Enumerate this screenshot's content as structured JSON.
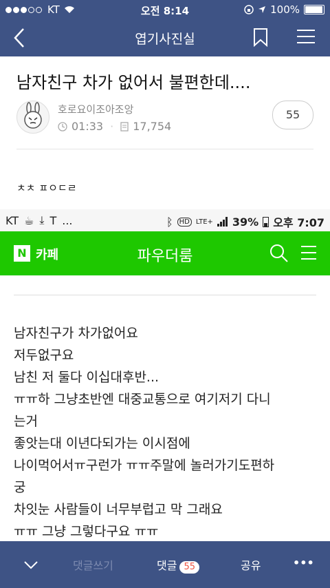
{
  "status_bar": {
    "carrier": "KT",
    "time": "오전 8:14",
    "battery_percent": "100%"
  },
  "nav": {
    "title": "엽기사진실"
  },
  "post": {
    "title": "남자친구 차가 없어서 불편한데....",
    "author": "호로요이조아조앙",
    "duration": "01:33",
    "views": "17,754",
    "comment_count": "55",
    "text": "ㅊㅊ ㅍㅇㄷㄹ"
  },
  "embedded": {
    "status": {
      "carrier": "KT",
      "more": "...",
      "battery": "39%",
      "time": "오후 7:07",
      "hd": "HD",
      "lte": "LTE+"
    },
    "header": {
      "logo": "N",
      "cafe_label": "카페",
      "cafe_name": "파우더룸"
    },
    "lines": [
      "남자친구가 차가없어요",
      "저두없구요",
      "남친 저 둘다 이십대후반...",
      "ㅠㅠ하 그냥초반엔 대중교통으로 여기저기 다니",
      "는거",
      "좋앗는대 이년다되가는 이시점에",
      "나이먹어서ㅠ구런가 ㅠㅠ주말에 놀러가기도편하",
      "궁",
      "차잇눈 사람들이 너무부럽고 막 그래요",
      "ㅠㅠ 그냥 그렇다구요 ㅠㅠ"
    ]
  },
  "bottom_bar": {
    "write_comment": "댓글쓰기",
    "comments_label": "댓글",
    "comments_count": "55",
    "share": "공유"
  }
}
